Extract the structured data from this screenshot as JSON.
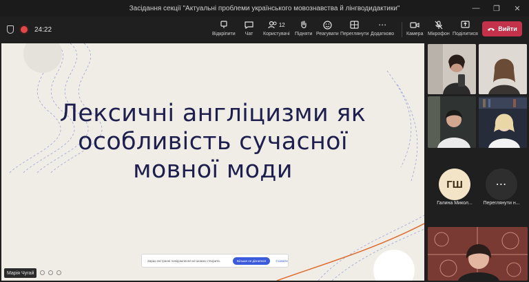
{
  "window": {
    "title": "Засідання секції \"Актуальні проблеми українського мовознавства й лінгводидактики\"",
    "controls": [
      "—",
      "❐",
      "✕"
    ]
  },
  "toolbar": {
    "timer": "24:22",
    "items": [
      {
        "label": "Відкріпити",
        "icon": "unpin-icon"
      },
      {
        "label": "Чат",
        "icon": "chat-icon"
      },
      {
        "label": "Користувачі",
        "icon": "people-icon",
        "count": "12"
      },
      {
        "label": "Підняти",
        "icon": "raise-hand-icon"
      },
      {
        "label": "Реагувати",
        "icon": "react-icon"
      },
      {
        "label": "Переглянути",
        "icon": "view-icon"
      },
      {
        "label": "Додатково",
        "icon": "more-icon"
      },
      {
        "label": "Камера",
        "icon": "camera-icon"
      },
      {
        "label": "Мікрофон",
        "icon": "mic-off-icon"
      },
      {
        "label": "Поділитися",
        "icon": "share-icon"
      }
    ],
    "leave_label": "Вийти"
  },
  "slide": {
    "title_line1": "Лексичні англіцизми як",
    "title_line2": "особливість сучасної",
    "title_line3": "мовної моди"
  },
  "notice": {
    "text": "Зараз екстранні повідомлення не можна створити.",
    "primary_label": "Більше не дізнатися",
    "secondary_label": "Сховати"
  },
  "presenter": {
    "name": "Марія Чугай"
  },
  "participants": {
    "avatar_initials": "ГШ",
    "avatar_name": "Галина Микол...",
    "more_label": "Переглянути н..."
  },
  "colors": {
    "slide_bg": "#efede6",
    "slide_title": "#1e1f4e",
    "leave": "#c4314b",
    "avatar": "#f3e3c7"
  }
}
